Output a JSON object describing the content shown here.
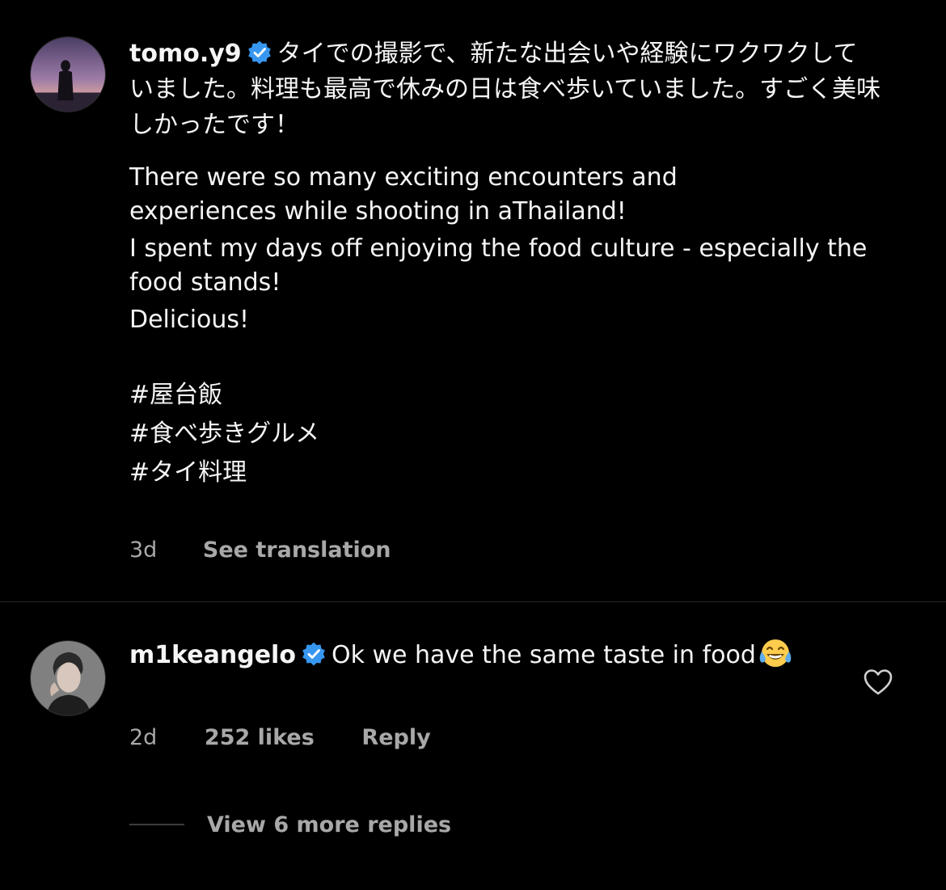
{
  "comment": {
    "username": "tomo.y9",
    "verified": true,
    "text_jp_lines": [
      "タイでの撮影で、新たな出会いや経験にワクワクして",
      "いました。料理も最高で休みの日は食べ歩いていました。すごく美味",
      "しかったです！"
    ],
    "text_en_paragraphs": [
      "There were so many exciting encounters and experiences while shooting in aThailand!",
      "I spent my days off enjoying the food culture - especially the food stands!",
      "Delicious!"
    ],
    "hashtags": [
      "#屋台飯",
      "#食べ歩きグルメ",
      "#タイ料理"
    ],
    "time": "3d",
    "see_translation_label": "See translation"
  },
  "reply": {
    "username": "m1keangelo",
    "verified": true,
    "text": "Ok we have the same taste in food",
    "emoji": "face-with-tears-of-joy",
    "time": "2d",
    "likes": "252 likes",
    "reply_label": "Reply"
  },
  "view_more_replies_label": "View 6 more replies",
  "colors": {
    "background": "#000000",
    "text_primary": "#f5f5f5",
    "text_secondary": "#a8a8a8",
    "verified_badge": "#3797f0",
    "divider": "#262626"
  }
}
